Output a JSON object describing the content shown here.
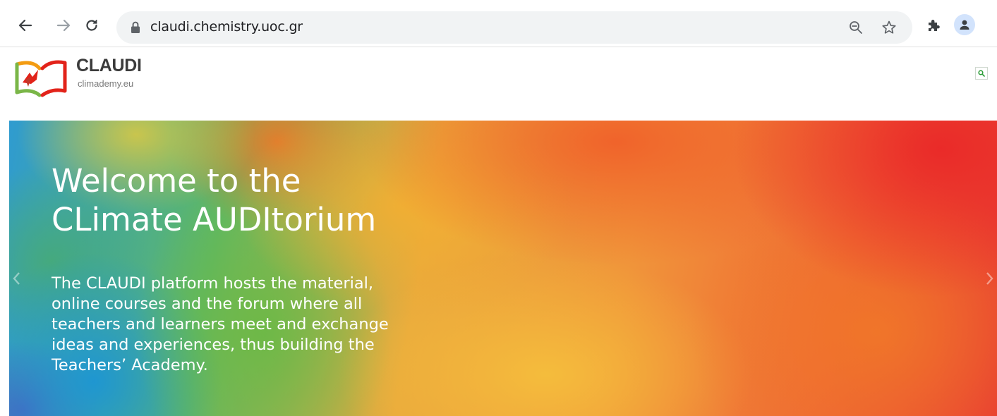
{
  "browser": {
    "url": "claudi.chemistry.uoc.gr"
  },
  "site": {
    "logo_title": "CLAUDI",
    "logo_subtitle": "climademy.eu"
  },
  "hero": {
    "title_line1": "Welcome to the",
    "title_line2": "CLimate AUDItorium",
    "body_lines": [
      "The CLAUDI platform hosts the material,",
      "online courses and the forum where all",
      "teachers and learners meet and exchange",
      "ideas and experiences, thus building the",
      "Teachers’ Academy."
    ]
  },
  "icons": {
    "back": "arrow-left-icon",
    "forward": "arrow-right-icon",
    "reload": "reload-icon",
    "lock": "lock-icon",
    "zoom": "zoom-out-icon",
    "bookmark": "star-icon",
    "extensions": "puzzle-icon",
    "profile": "person-icon",
    "site_search": "search-icon",
    "carousel_prev": "chevron-left-icon",
    "carousel_next": "chevron-right-icon"
  },
  "colors": {
    "logo_red": "#e2231a",
    "logo_green": "#7ab648",
    "logo_orange": "#f39c12",
    "hero_text": "#ffffff"
  }
}
